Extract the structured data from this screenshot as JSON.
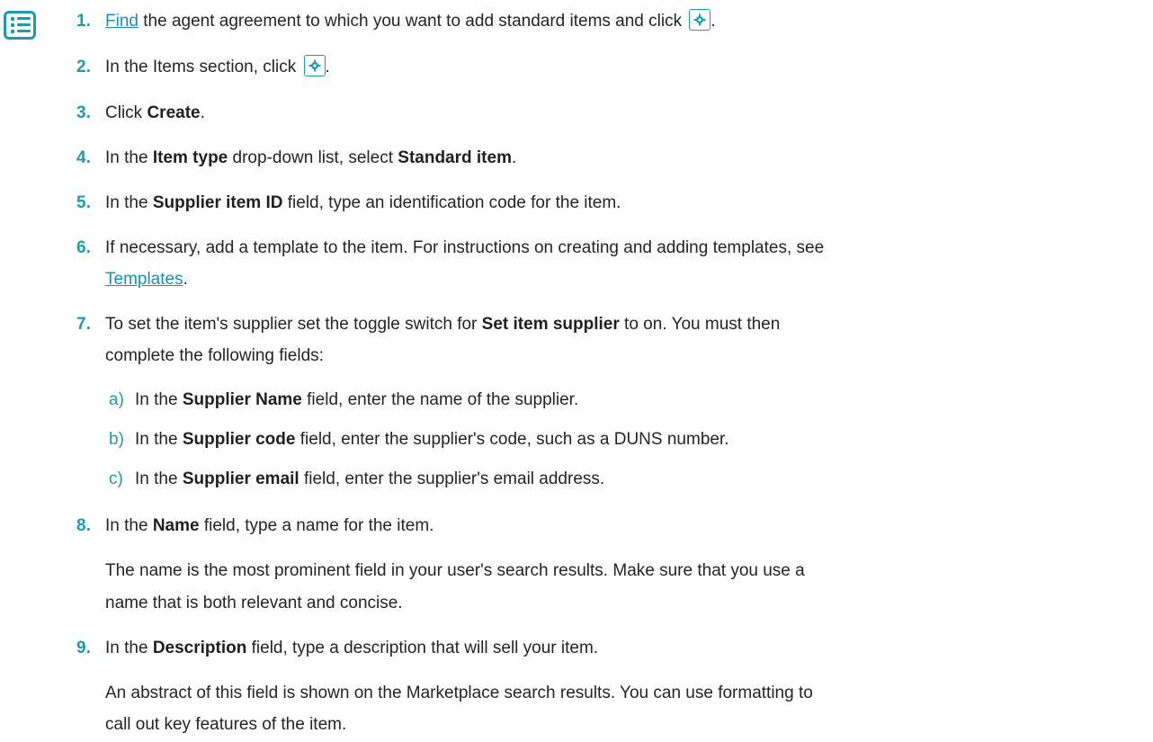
{
  "icons": {
    "steps": "checklist-icon",
    "gear": "gear-icon"
  },
  "colors": {
    "accent": "#1a9bb0",
    "link": "#1a8fb3",
    "text": "#242424"
  },
  "steps": [
    {
      "num": "1.",
      "link": "Find",
      "text": " the agent agreement to which you want to add standard items and click ",
      "end": "."
    },
    {
      "num": "2.",
      "pre": "In the Items section, click ",
      "end": "."
    },
    {
      "num": "3.",
      "pre": "Click ",
      "bold": "Create",
      "post": "."
    },
    {
      "num": "4.",
      "pre": "In the ",
      "bold": "Item type",
      "mid": " drop-down list, select ",
      "bold2": "Standard item",
      "post": "."
    },
    {
      "num": "5.",
      "pre": "In the ",
      "bold": "Supplier item ID",
      "post": " field, type an identification code for the item."
    },
    {
      "num": "6.",
      "line1": "If necessary, add a template to the item. For instructions on creating and adding templates, see",
      "link": "Templates",
      "end": "."
    },
    {
      "num": "7.",
      "pre": "To set the item's supplier set the toggle switch for ",
      "bold": "Set item supplier",
      "post": " to on. You must then",
      "line2": "complete the following fields:"
    },
    {
      "num": "8.",
      "pre": "In the ",
      "bold": "Name",
      "post": " field, type a name for the item.",
      "para1": "The name is the most prominent field in your user's search results. Make sure that you use a",
      "para2": "name that is both relevant and concise."
    },
    {
      "num": "9.",
      "pre": "In the ",
      "bold": "Description",
      "post": " field, type a description that will sell your item.",
      "para1": "An abstract of this field is shown on the Marketplace search results. You can use formatting to",
      "para2": "call out key features of the item."
    }
  ],
  "substeps": [
    {
      "letter": "a)",
      "pre": "In the ",
      "bold": "Supplier Name",
      "post": " field, enter the name of the supplier."
    },
    {
      "letter": "b)",
      "pre": "In the ",
      "bold": "Supplier code",
      "post": " field, enter the supplier's code, such as a DUNS number."
    },
    {
      "letter": "c)",
      "pre": "In the ",
      "bold": "Supplier email",
      "post": " field, enter the supplier's email address."
    }
  ]
}
